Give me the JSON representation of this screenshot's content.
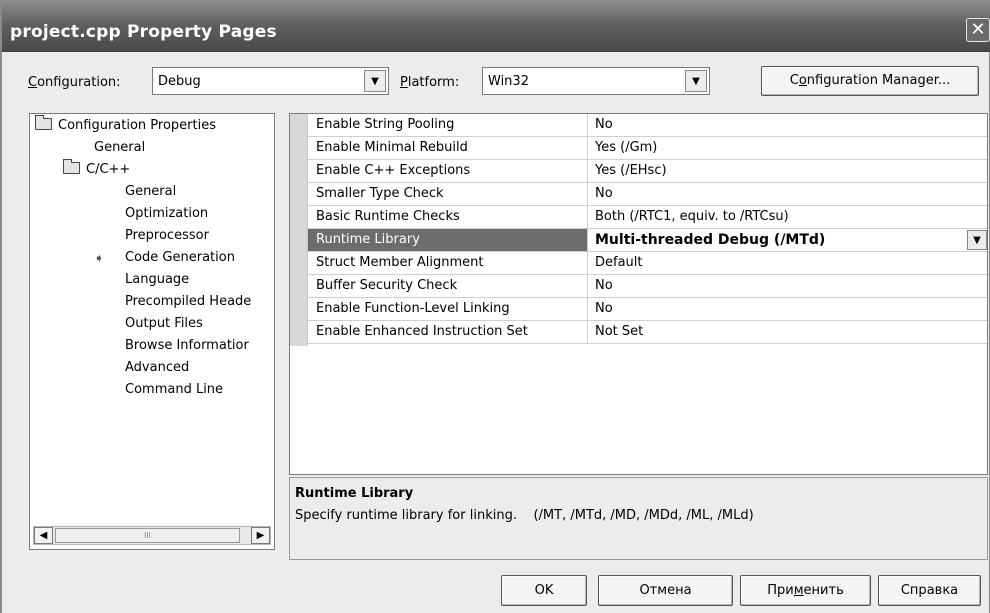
{
  "window": {
    "title": "project.cpp Property Pages",
    "close_glyph": "✕"
  },
  "toolbar": {
    "configuration_label_u": "C",
    "configuration_label_rest": "onfiguration:",
    "configuration_value": "Debug",
    "platform_label_u": "P",
    "platform_label_rest": "latform:",
    "platform_value": "Win32",
    "config_manager_pre": "C",
    "config_manager_u": "o",
    "config_manager_post": "nfiguration Manager..."
  },
  "tree": {
    "items": [
      {
        "label": "Configuration Properties"
      },
      {
        "label": "General"
      },
      {
        "label": "C/C++"
      },
      {
        "label": "General"
      },
      {
        "label": "Optimization"
      },
      {
        "label": "Preprocessor"
      },
      {
        "label": "Code Generation"
      },
      {
        "label": "Language"
      },
      {
        "label": "Precompiled Heade"
      },
      {
        "label": "Output Files"
      },
      {
        "label": "Browse Informatior"
      },
      {
        "label": "Advanced"
      },
      {
        "label": "Command Line"
      }
    ],
    "scroll_thumb_grip": "III"
  },
  "properties": [
    {
      "name": "Enable String Pooling",
      "value": "No"
    },
    {
      "name": "Enable Minimal Rebuild",
      "value": "Yes (/Gm)"
    },
    {
      "name": "Enable C++ Exceptions",
      "value": "Yes (/EHsc)"
    },
    {
      "name": "Smaller Type Check",
      "value": "No"
    },
    {
      "name": "Basic Runtime Checks",
      "value": "Both (/RTC1, equiv. to /RTCsu)"
    },
    {
      "name": "Runtime Library",
      "value": "Multi-threaded Debug (/MTd)"
    },
    {
      "name": "Struct Member Alignment",
      "value": "Default"
    },
    {
      "name": "Buffer Security Check",
      "value": "No"
    },
    {
      "name": "Enable Function-Level Linking",
      "value": "No"
    },
    {
      "name": "Enable Enhanced Instruction Set",
      "value": "Not Set"
    }
  ],
  "description": {
    "title": "Runtime Library",
    "text": "Specify runtime library for linking.    (/MT, /MTd, /MD, /MDd, /ML, /MLd)"
  },
  "buttons": {
    "ok": "OK",
    "cancel": "Отмена",
    "apply_pre": "При",
    "apply_u": "м",
    "apply_post": "енить",
    "help": "Справка"
  }
}
